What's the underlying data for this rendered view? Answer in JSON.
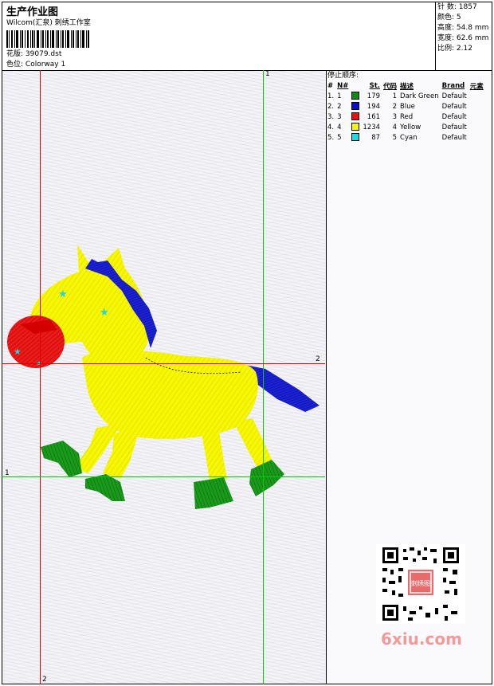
{
  "header": {
    "title": "生产作业图",
    "studio": "Wilcom(汇泉) 刺绣工作室",
    "design_file_label": "花版:",
    "design_file": "39079.dst",
    "colorway_label": "色位:",
    "colorway": "Colorway 1"
  },
  "stats": [
    {
      "label": "针 数:",
      "value": "1857"
    },
    {
      "label": "颜色:",
      "value": "5"
    },
    {
      "label": "高度:",
      "value": "54.8 mm"
    },
    {
      "label": "宽度:",
      "value": "62.6 mm"
    },
    {
      "label": "比例:",
      "value": "2.12"
    }
  ],
  "stop_sequence": {
    "title": "停止顺序:",
    "columns": [
      "#",
      "N#",
      "St.",
      "代码",
      "描述",
      "Brand",
      "元素"
    ],
    "rows": [
      {
        "num": "1.",
        "n": "1",
        "color": "#118a11",
        "st": "179",
        "code": "1",
        "desc": "Dark Green",
        "brand": "Default"
      },
      {
        "num": "2.",
        "n": "2",
        "color": "#0a10c8",
        "st": "194",
        "code": "2",
        "desc": "Blue",
        "brand": "Default"
      },
      {
        "num": "3.",
        "n": "3",
        "color": "#e81010",
        "st": "161",
        "code": "3",
        "desc": "Red",
        "brand": "Default"
      },
      {
        "num": "4.",
        "n": "4",
        "color": "#f5f500",
        "st": "1234",
        "code": "4",
        "desc": "Yellow",
        "brand": "Default"
      },
      {
        "num": "5.",
        "n": "5",
        "color": "#20d8e0",
        "st": "87",
        "code": "5",
        "desc": "Cyan",
        "brand": "Default"
      }
    ]
  },
  "guides": {
    "v1_label": "1",
    "v2_label": "2",
    "h1_label": "1",
    "h2_label": "2",
    "v1_color": "#00cc00",
    "v2_color": "#dd0000"
  },
  "watermark": "6xiu.com",
  "qr_badge": "刺绣图"
}
